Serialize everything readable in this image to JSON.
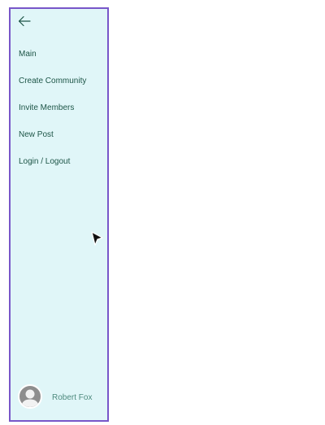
{
  "drawer": {
    "back_icon": "arrow-left-icon",
    "nav_items": [
      {
        "label": "Main"
      },
      {
        "label": "Create Community"
      },
      {
        "label": "Invite Members"
      },
      {
        "label": "New Post"
      },
      {
        "label": "Login / Logout"
      }
    ],
    "profile": {
      "name": "Robert Fox",
      "avatar_icon": "user-avatar-icon"
    }
  },
  "colors": {
    "drawer_background": "#e0f6f8",
    "drawer_border": "#7856c9",
    "text": "#1d5547",
    "profile_text": "#4e8a7e"
  }
}
